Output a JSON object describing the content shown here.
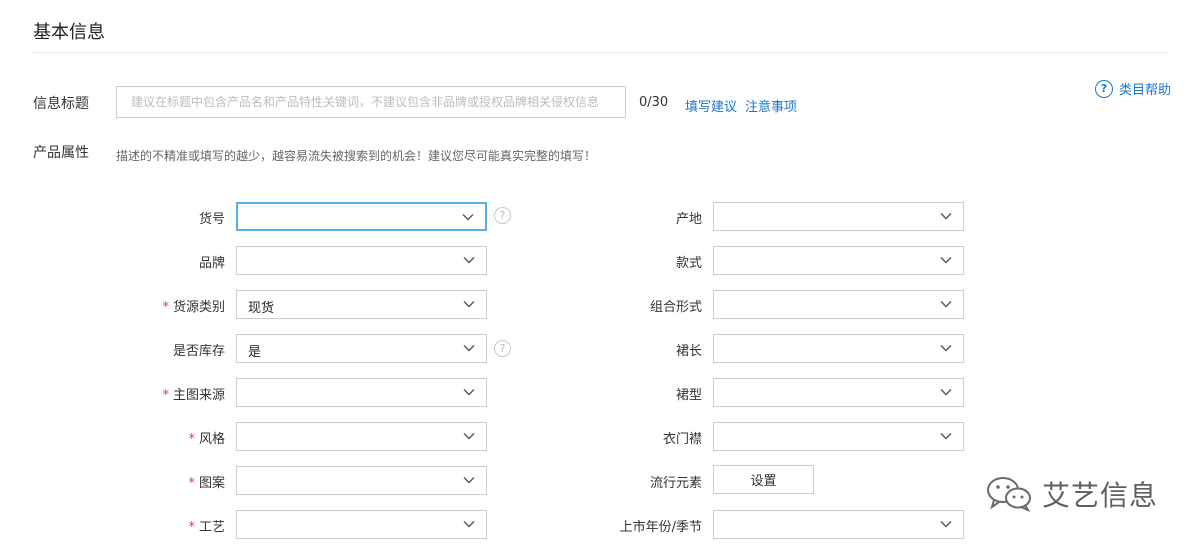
{
  "section": {
    "title": "基本信息"
  },
  "title_field": {
    "label": "信息标题",
    "placeholder": "建议在标题中包含产品名和产品特性关键词，不建议包含非品牌或授权品牌相关侵权信息",
    "value": "",
    "counter": "0/30",
    "link_suggest": "填写建议",
    "link_notes": "注意事项"
  },
  "help": {
    "label": "类目帮助",
    "icon": "question-circle-icon"
  },
  "attributes": {
    "label": "产品属性",
    "hint": "描述的不精准或填写的越少，越容易流失被搜索到的机会！建议您尽可能真实完整的填写！"
  },
  "left_fields": [
    {
      "label": "货号",
      "required": false,
      "value": "",
      "help": true
    },
    {
      "label": "品牌",
      "required": false,
      "value": "",
      "help": false
    },
    {
      "label": "货源类别",
      "required": true,
      "value": "现货",
      "help": false
    },
    {
      "label": "是否库存",
      "required": false,
      "value": "是",
      "help": true
    },
    {
      "label": "主图来源",
      "required": true,
      "value": "",
      "help": false
    },
    {
      "label": "风格",
      "required": true,
      "value": "",
      "help": false
    },
    {
      "label": "图案",
      "required": true,
      "value": "",
      "help": false
    },
    {
      "label": "工艺",
      "required": true,
      "value": "",
      "help": false
    }
  ],
  "right_fields": [
    {
      "label": "产地",
      "value": ""
    },
    {
      "label": "款式",
      "value": ""
    },
    {
      "label": "组合形式",
      "value": ""
    },
    {
      "label": "裙长",
      "value": ""
    },
    {
      "label": "裙型",
      "value": ""
    },
    {
      "label": "衣门襟",
      "value": ""
    },
    {
      "label": "流行元素",
      "button": "设置"
    },
    {
      "label": "上市年份/季节",
      "value": ""
    }
  ],
  "required_mark": "*",
  "help_mark": "?",
  "watermark": {
    "text": "艾艺信息",
    "icon": "wechat-icon"
  }
}
